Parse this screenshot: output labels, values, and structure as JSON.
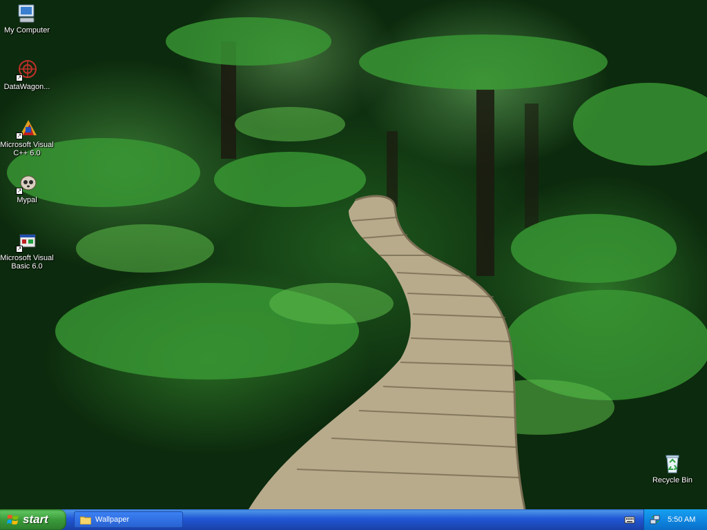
{
  "desktop": {
    "icons": [
      {
        "label": "My Computer",
        "icon": "my-computer-icon"
      },
      {
        "label": "DataWagon...",
        "icon": "datawagon-icon"
      },
      {
        "label": "Microsoft Visual C++ 6.0",
        "icon": "visual-cpp-icon"
      },
      {
        "label": "Mypal",
        "icon": "mypal-icon"
      },
      {
        "label": "Microsoft Visual Basic 6.0",
        "icon": "visual-basic-icon"
      },
      {
        "label": "Recycle Bin",
        "icon": "recycle-bin-icon"
      }
    ]
  },
  "taskbar": {
    "start_label": "start",
    "windows": [
      {
        "label": "Wallpaper",
        "icon": "folder-icon"
      }
    ],
    "clock": "5:50 AM"
  },
  "colors": {
    "taskbar": "#2157d7",
    "start_button": "#3a9a3a",
    "tray": "#0f87e0"
  }
}
